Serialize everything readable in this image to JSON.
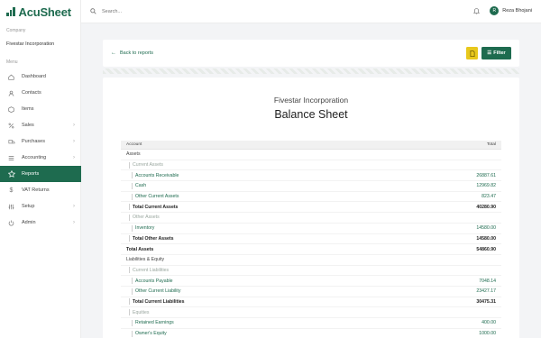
{
  "app": {
    "name": "AcuSheet",
    "brand_color": "#1e6b4f"
  },
  "sidebar": {
    "company_label": "Company",
    "company_name": "Fivestar Incorporation",
    "menu_label": "Menu",
    "items": [
      {
        "label": "Dashboard",
        "icon": "home-icon",
        "chevron": false,
        "active": false
      },
      {
        "label": "Contacts",
        "icon": "contacts-icon",
        "chevron": false,
        "active": false
      },
      {
        "label": "Items",
        "icon": "box-icon",
        "chevron": false,
        "active": false
      },
      {
        "label": "Sales",
        "icon": "percent-icon",
        "chevron": true,
        "active": false
      },
      {
        "label": "Purchases",
        "icon": "truck-icon",
        "chevron": true,
        "active": false
      },
      {
        "label": "Accounting",
        "icon": "list-icon",
        "chevron": true,
        "active": false
      },
      {
        "label": "Reports",
        "icon": "star-icon",
        "chevron": false,
        "active": true
      },
      {
        "label": "VAT Returns",
        "icon": "dollar-icon",
        "chevron": false,
        "active": false
      },
      {
        "label": "Setup",
        "icon": "sliders-icon",
        "chevron": true,
        "active": false
      },
      {
        "label": "Admin",
        "icon": "power-icon",
        "chevron": true,
        "active": false
      }
    ]
  },
  "topbar": {
    "search_placeholder": "Search...",
    "user_initial": "R",
    "user_name": "Reza Bhojani"
  },
  "toolbar": {
    "back_label": "Back to reports",
    "filter_label": "Filter"
  },
  "report": {
    "company": "Fivestar Incorporation",
    "title": "Balance Sheet",
    "columns": {
      "account": "Account",
      "total": "Total"
    },
    "rows": [
      {
        "type": "section",
        "label": "Assets",
        "value": ""
      },
      {
        "type": "group",
        "label": "Current Assets",
        "value": ""
      },
      {
        "type": "account",
        "label": "Accounts Receivable",
        "value": "26887.61"
      },
      {
        "type": "account",
        "label": "Cash",
        "value": "12969.82"
      },
      {
        "type": "account",
        "label": "Other Current Assets",
        "value": "823.47"
      },
      {
        "type": "subtotal",
        "label": "Total Current Assets",
        "value": "40280.90"
      },
      {
        "type": "group",
        "label": "Other Assets",
        "value": ""
      },
      {
        "type": "account",
        "label": "Inventory",
        "value": "14580.00"
      },
      {
        "type": "subtotal",
        "label": "Total Other Assets",
        "value": "14580.00"
      },
      {
        "type": "total",
        "label": "Total Assets",
        "value": "54860.90"
      },
      {
        "type": "section",
        "label": "Liabilities & Equity",
        "value": ""
      },
      {
        "type": "group",
        "label": "Current Liabilities",
        "value": ""
      },
      {
        "type": "account",
        "label": "Accounts Payable",
        "value": "7048.14"
      },
      {
        "type": "account",
        "label": "Other Current Liability",
        "value": "23427.17"
      },
      {
        "type": "subtotal",
        "label": "Total Current Liabilities",
        "value": "30475.31"
      },
      {
        "type": "group",
        "label": "Equities",
        "value": ""
      },
      {
        "type": "account",
        "label": "Retained Earnings",
        "value": "400.00"
      },
      {
        "type": "account",
        "label": "Owner's Equity",
        "value": "1000.00"
      }
    ]
  }
}
